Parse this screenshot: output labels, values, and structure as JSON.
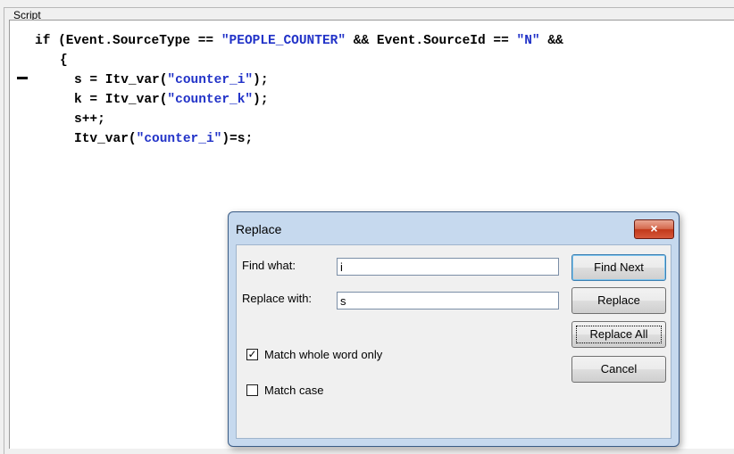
{
  "group": {
    "label": "Script"
  },
  "code": {
    "lines": [
      {
        "a": "if (Event.SourceType == ",
        "s1": "\"PEOPLE_COUNTER\"",
        "b": " && Event.SourceId == ",
        "s2": "\"N\"",
        "c": " &&"
      },
      {
        "a": "{"
      },
      {
        "a": "s = Itv_var(",
        "s1": "\"counter_i\"",
        "b": ");"
      },
      {
        "a": "k = Itv_var(",
        "s1": "\"counter_k\"",
        "b": ");"
      },
      {
        "a": "s++;"
      },
      {
        "a": "Itv_var(",
        "s1": "\"counter_i\"",
        "b": ")=s;"
      }
    ]
  },
  "dialog": {
    "title": "Replace",
    "close_icon": "×",
    "find_label": "Find what:",
    "find_value": "i",
    "replace_label": "Replace with:",
    "replace_value": "s",
    "match_whole_word_label": "Match whole word only",
    "match_whole_word_checked": "✓",
    "match_case_label": "Match case",
    "buttons": {
      "find_next": "Find Next",
      "replace": "Replace",
      "replace_all": "Replace All",
      "cancel": "Cancel"
    }
  },
  "colors": {
    "string": "#2233c8",
    "dialog_frame": "#c6d9ee",
    "close_button": "#c1381a"
  }
}
